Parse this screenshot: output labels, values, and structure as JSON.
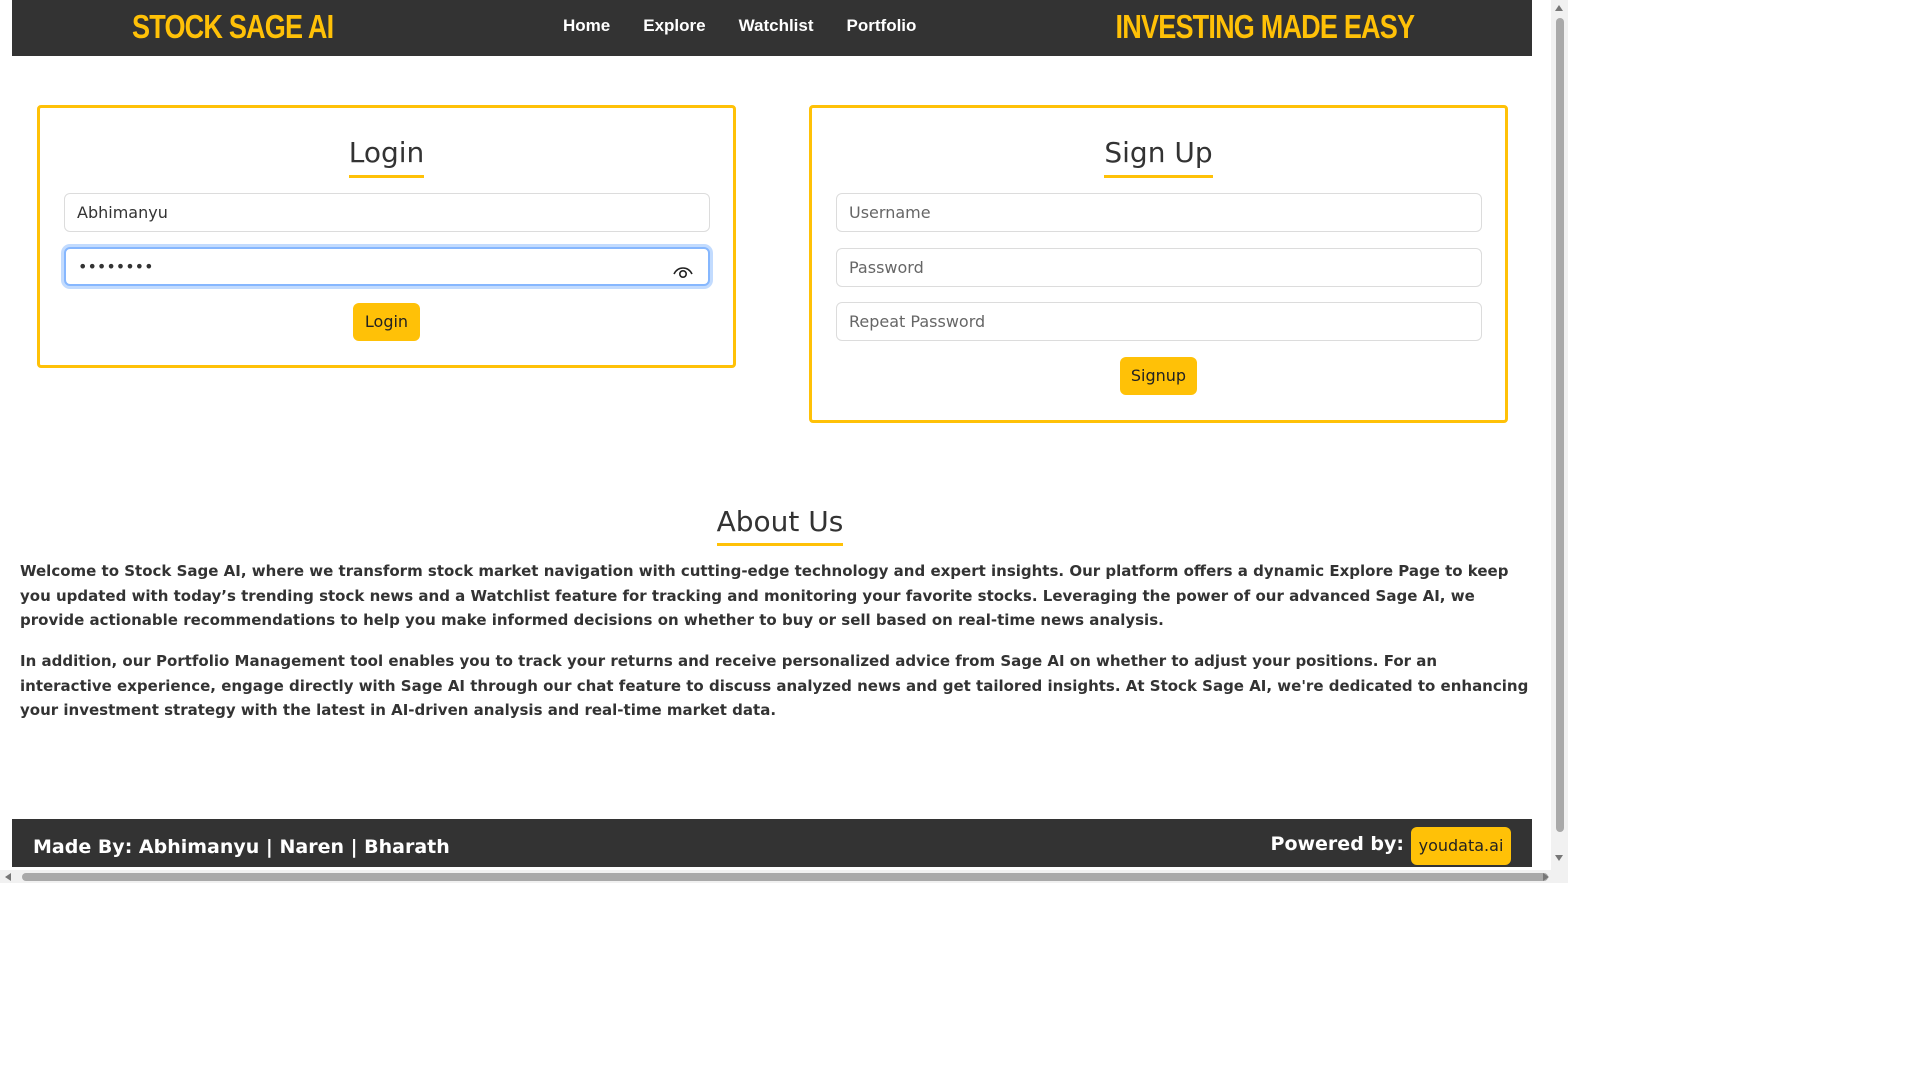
{
  "header": {
    "brand": "STOCK SAGE AI",
    "tagline": "INVESTING MADE EASY",
    "nav": [
      "Home",
      "Explore",
      "Watchlist",
      "Portfolio"
    ]
  },
  "login": {
    "title": "Login",
    "username_value": "Abhimanyu",
    "password_value": "••••••••",
    "button": "Login"
  },
  "signup": {
    "title": "Sign Up",
    "username_placeholder": "Username",
    "password_placeholder": "Password",
    "repeat_placeholder": "Repeat Password",
    "button": "Signup"
  },
  "about": {
    "title": "About Us",
    "p1": "Welcome to Stock Sage AI, where we transform stock market navigation with cutting-edge technology and expert insights. Our platform offers a dynamic Explore Page to keep you updated with today’s trending stock news and a Watchlist feature for tracking and monitoring your favorite stocks. Leveraging the power of our advanced Sage AI, we provide actionable recommendations to help you make informed decisions on whether to buy or sell based on real-time news analysis.",
    "p2": "In addition, our Portfolio Management tool enables you to track your returns and receive personalized advice from Sage AI on whether to adjust your positions. For an interactive experience, engage directly with Sage AI through our chat feature to discuss analyzed news and get tailored insights. At Stock Sage AI, we're dedicated to enhancing your investment strategy with the latest in AI-driven analysis and real-time market data."
  },
  "footer": {
    "made_by": "Made By: Abhimanyu | Naren | Bharath",
    "powered_by": "Powered by:",
    "powered_link": "youdata.ai"
  },
  "colors": {
    "accent": "#FFC107",
    "header_bg": "#333333",
    "focus_ring": "#86b7fe"
  }
}
